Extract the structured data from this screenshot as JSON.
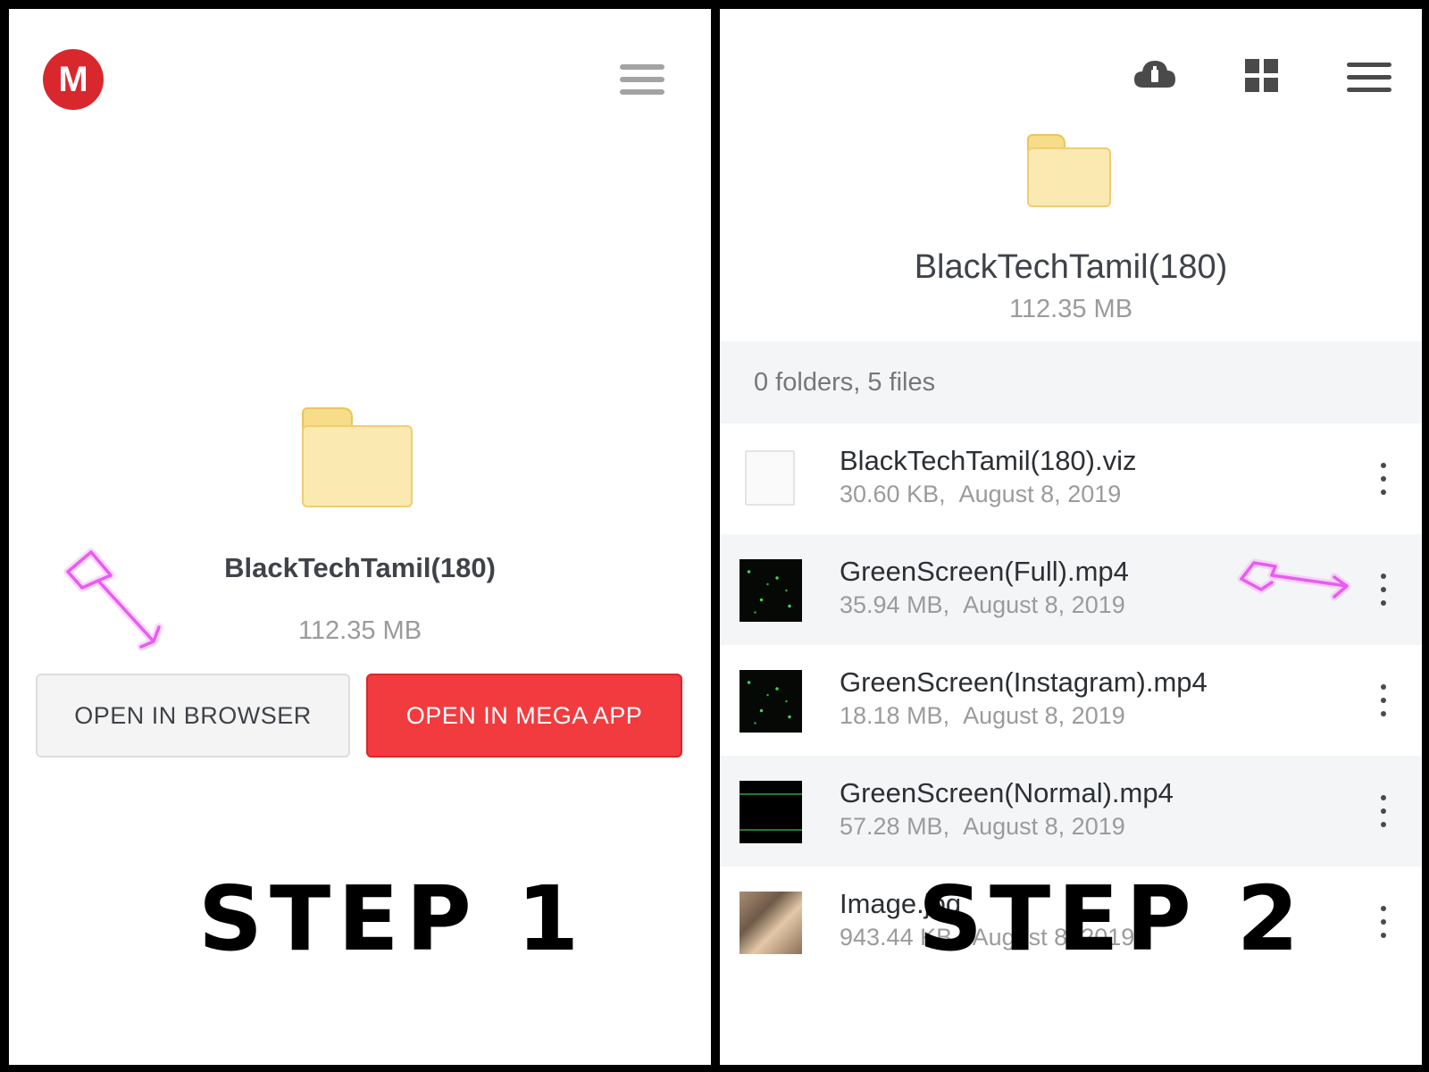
{
  "step1": {
    "logo_letter": "M",
    "folder_name": "BlackTechTamil(180)",
    "folder_size": "112.35 MB",
    "open_browser_label": "OPEN IN BROWSER",
    "open_mega_label": "OPEN IN MEGA APP",
    "step_label": "STEP 1"
  },
  "step2": {
    "folder_name": "BlackTechTamil(180)",
    "folder_size": "112.35 MB",
    "summary": "0 folders, 5 files",
    "files": [
      {
        "name": "BlackTechTamil(180).viz",
        "size": "30.60 KB,",
        "date": "August 8, 2019"
      },
      {
        "name": "GreenScreen(Full).mp4",
        "size": "35.94 MB,",
        "date": "August 8, 2019"
      },
      {
        "name": "GreenScreen(Instagram).mp4",
        "size": "18.18 MB,",
        "date": "August 8, 2019"
      },
      {
        "name": "GreenScreen(Normal).mp4",
        "size": "57.28 MB,",
        "date": "August 8, 2019"
      },
      {
        "name": "Image.jpg",
        "size": "943.44 KB,",
        "date": "August 8, 2019"
      }
    ],
    "step_label": "STEP 2"
  },
  "colors": {
    "mega_red": "#d9272e",
    "button_red": "#f23b3f",
    "folder_yellow": "#fbe9b2",
    "annotation_pink": "#e85cf2"
  },
  "icons": [
    "mega-logo-icon",
    "hamburger-menu-icon",
    "cloud-download-icon",
    "grid-view-icon",
    "folder-icon",
    "file-icon",
    "more-options-icon"
  ]
}
